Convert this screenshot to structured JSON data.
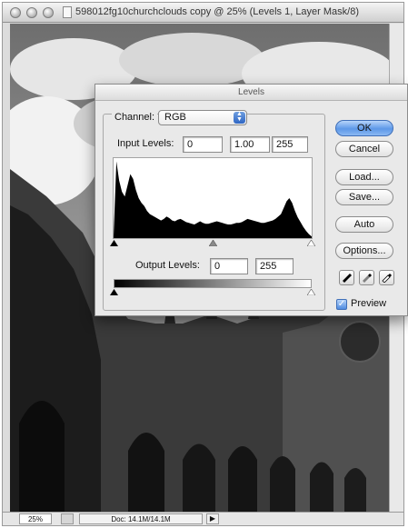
{
  "document_window": {
    "title": "598012fg10churchclouds copy @ 25% (Levels 1, Layer Mask/8)",
    "status": {
      "zoom": "25%",
      "doc_size": "Doc: 14.1M/14.1M",
      "menu_arrow": "▶"
    }
  },
  "levels_dialog": {
    "title": "Levels",
    "channel": {
      "label": "Channel:",
      "value": "RGB"
    },
    "input_levels": {
      "label": "Input Levels:",
      "shadows": "0",
      "midtones": "1.00",
      "highlights": "255"
    },
    "output_levels": {
      "label": "Output Levels:",
      "shadows": "0",
      "highlights": "255"
    },
    "buttons": {
      "ok": "OK",
      "cancel": "Cancel",
      "load": "Load...",
      "save": "Save...",
      "auto": "Auto",
      "options": "Options..."
    },
    "eyedroppers": [
      "black-point-eyedropper",
      "gray-point-eyedropper",
      "white-point-eyedropper"
    ],
    "preview": {
      "label": "Preview",
      "checked": true
    },
    "histogram_profile": [
      2,
      96,
      72,
      58,
      52,
      66,
      80,
      74,
      60,
      50,
      44,
      40,
      34,
      30,
      28,
      26,
      24,
      22,
      24,
      27,
      25,
      22,
      21,
      23,
      24,
      22,
      20,
      19,
      18,
      17,
      19,
      21,
      19,
      18,
      18,
      19,
      20,
      21,
      20,
      19,
      18,
      17,
      17,
      18,
      19,
      19,
      20,
      22,
      24,
      23,
      22,
      21,
      20,
      19,
      19,
      20,
      21,
      22,
      24,
      27,
      30,
      38,
      46,
      50,
      44,
      34,
      26,
      20,
      14,
      9,
      5,
      2
    ]
  },
  "colors": {
    "accent_blue": "#5d98e8",
    "dialog_bg": "#e9e9e9"
  }
}
